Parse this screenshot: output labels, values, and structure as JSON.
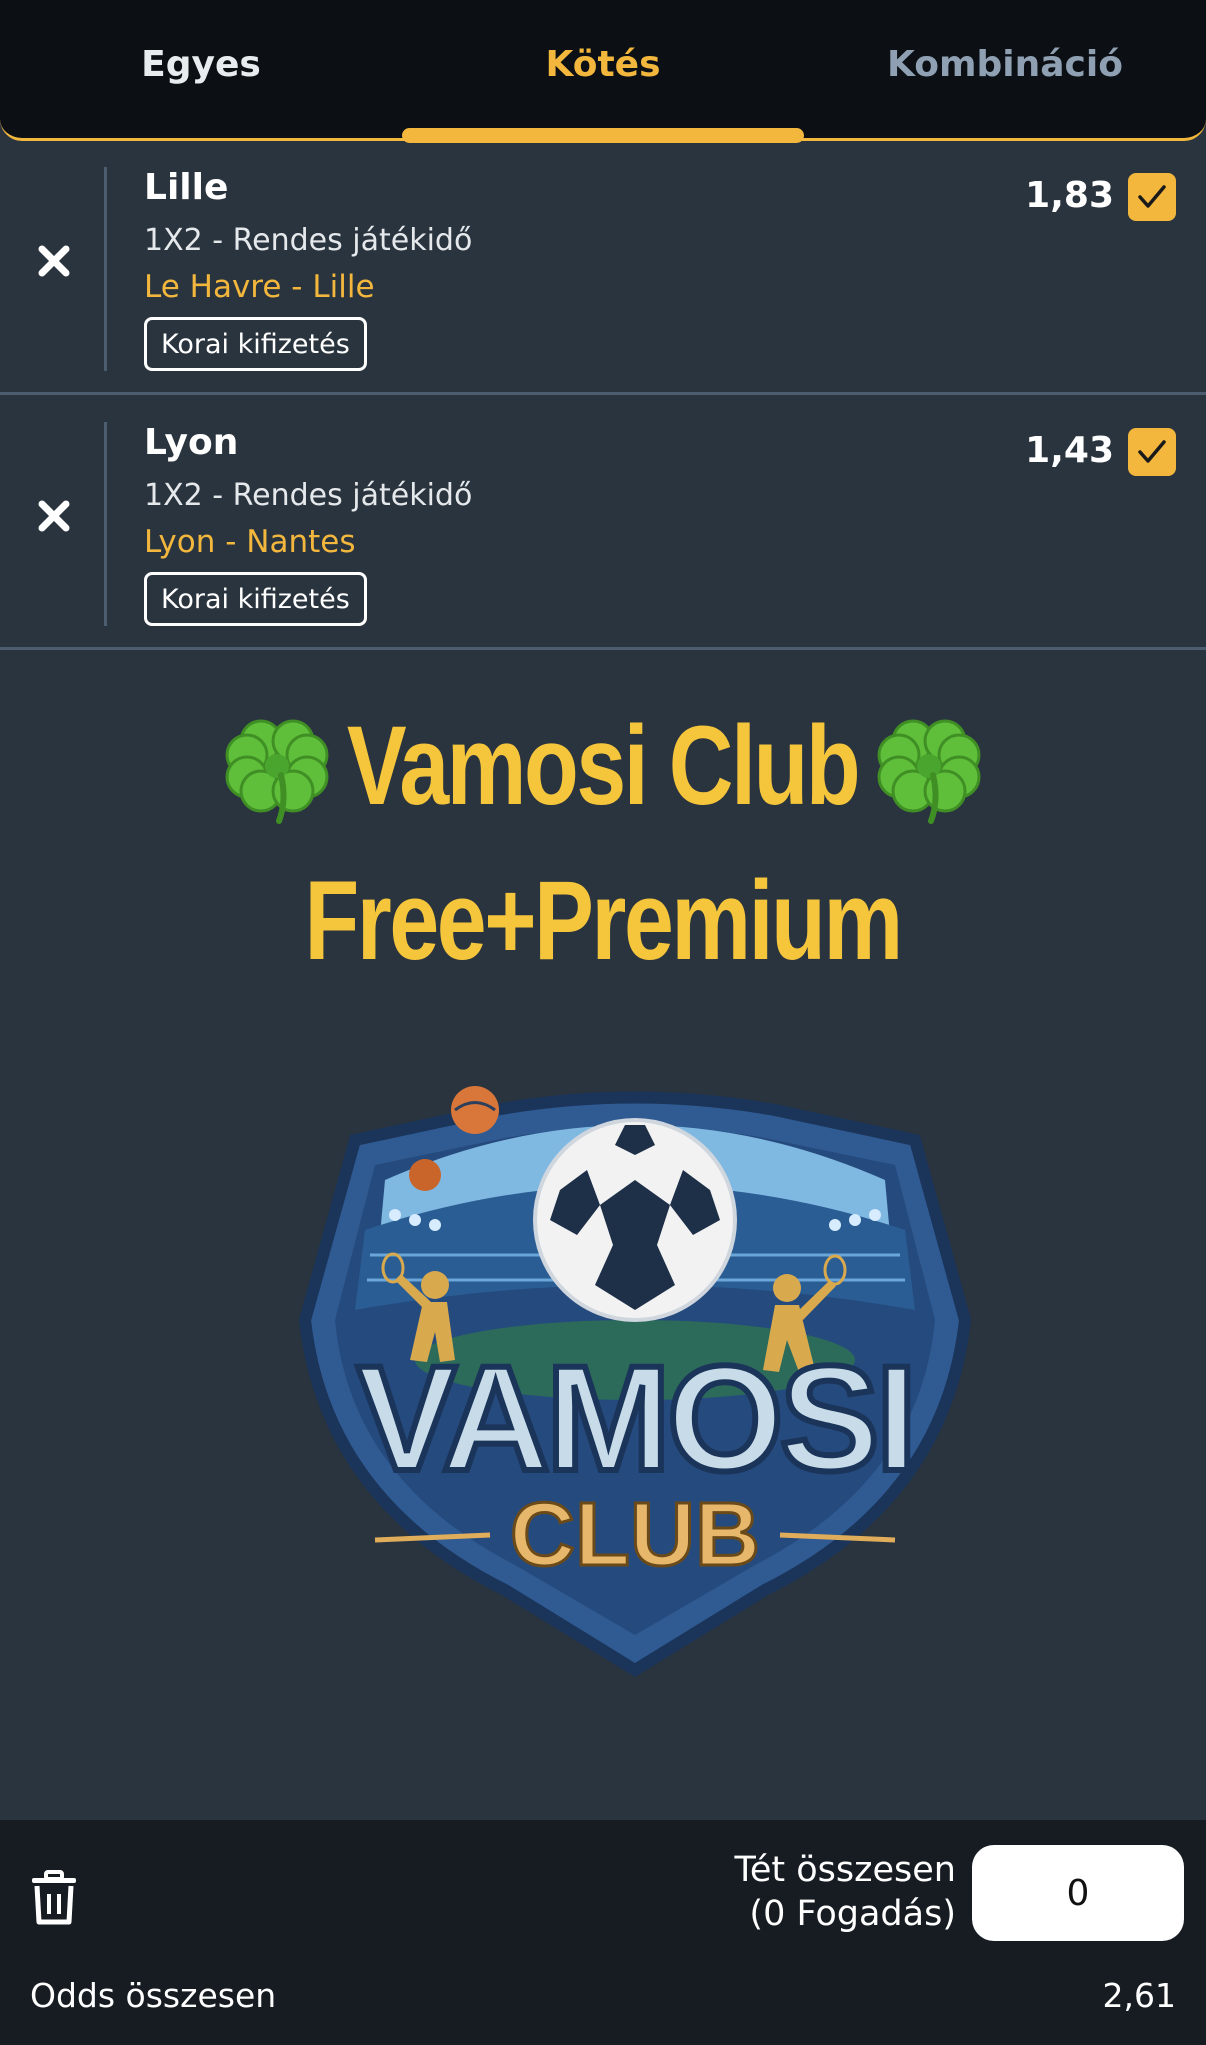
{
  "tabs": [
    {
      "label": "Egyes",
      "active": false
    },
    {
      "label": "Kötés",
      "active": true
    },
    {
      "label": "Kombináció",
      "active": false
    }
  ],
  "selections": [
    {
      "team": "Lille",
      "market": "1X2 - Rendes játékidő",
      "match": "Le Havre - Lille",
      "badge": "Korai kifizetés",
      "odds": "1,83",
      "checked": true
    },
    {
      "team": "Lyon",
      "market": "1X2 - Rendes játékidő",
      "match": "Lyon - Nantes",
      "badge": "Korai kifizetés",
      "odds": "1,43",
      "checked": true
    }
  ],
  "promo": {
    "line1": "Vamosi Club",
    "line2": "Free+Premium",
    "logo_word1": "VAMOSI",
    "logo_word2": "CLUB"
  },
  "footer": {
    "stake_label_line1": "Tét összesen",
    "stake_label_line2": "(0 Fogadás)",
    "stake_value": "0",
    "total_odds_label": "Odds összesen",
    "total_odds_value": "2,61"
  },
  "icons": {
    "remove": "close-icon",
    "check": "checkmark-icon",
    "clover": "four-leaf-clover-icon",
    "trash": "trash-icon"
  },
  "colors": {
    "accent": "#f2b73c",
    "background": "#2a343e",
    "header": "#0c1015",
    "footer": "#161c22",
    "promo_text": "#f5c53c"
  }
}
